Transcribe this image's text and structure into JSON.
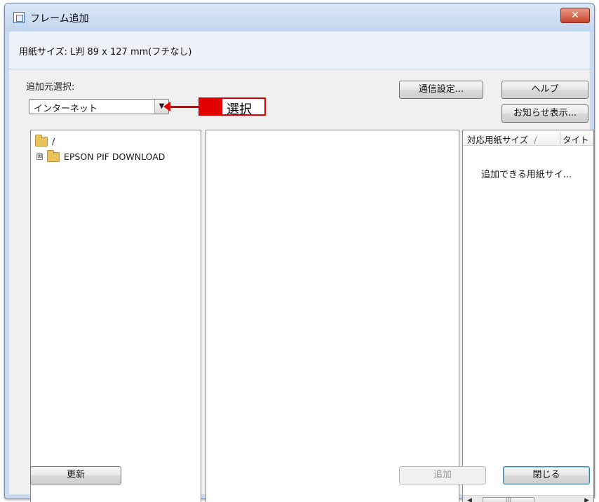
{
  "window": {
    "title": "フレーム追加",
    "close_glyph": "✕"
  },
  "info": {
    "paper_size": "用紙サイズ: L判 89 x 127 mm(フチなし)"
  },
  "source": {
    "label": "追加元選択:",
    "selected": "インターネット",
    "dropdown_glyph": "▼"
  },
  "annotation": {
    "text": "選択",
    "color": "#e00000"
  },
  "buttons": {
    "comm_settings": "通信設定...",
    "help": "ヘルプ",
    "notices": "お知らせ表示...",
    "refresh": "更新",
    "add": "追加",
    "close": "閉じる"
  },
  "tree": {
    "root": "/",
    "items": [
      {
        "label": "EPSON PIF DOWNLOAD",
        "expander": "⊞"
      }
    ]
  },
  "list": {
    "columns": [
      "対応用紙サイズ",
      "タイト"
    ],
    "sort_glyph": "/",
    "empty_message": "追加できる用紙サイ..."
  },
  "scroll": {
    "left": "◀",
    "right": "▶",
    "grip": "|||"
  }
}
